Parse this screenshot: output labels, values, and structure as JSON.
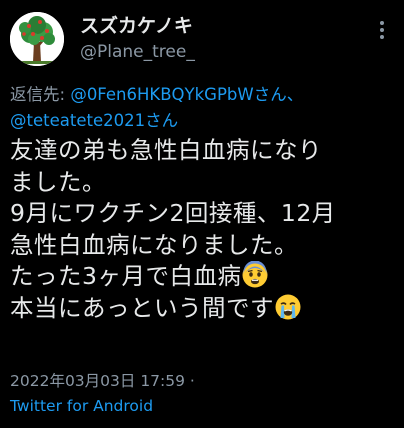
{
  "user": {
    "display_name": "スズカケノキ",
    "handle": "@Plane_tree_",
    "avatar_icon": "tree-icon"
  },
  "more_icon": "more-vertical-icon",
  "reply": {
    "prefix": "返信先: ",
    "mention_1": "@0Fen6HKBQYkGPbW",
    "suffix_1": "さん、",
    "mention_2": "@teteatete2021",
    "suffix_2": "さん"
  },
  "body": {
    "line_1": "友達の弟も急性白血病になり",
    "line_2": "ました。",
    "line_3": "9月にワクチン2回接種、12月",
    "line_4": "急性白血病になりました。",
    "line_5": "たった3ヶ月で白血病",
    "line_5_emoji": "fearful-face-emoji",
    "line_6": "本当にあっという間です",
    "line_6_emoji": "crying-face-emoji"
  },
  "meta": {
    "timestamp": "2022年03月03日 17:59 ·",
    "source": "Twitter for Android"
  },
  "colors": {
    "background": "#000000",
    "text": "#e7e9ea",
    "secondary": "#8b98a5",
    "link": "#1d9bf0"
  }
}
